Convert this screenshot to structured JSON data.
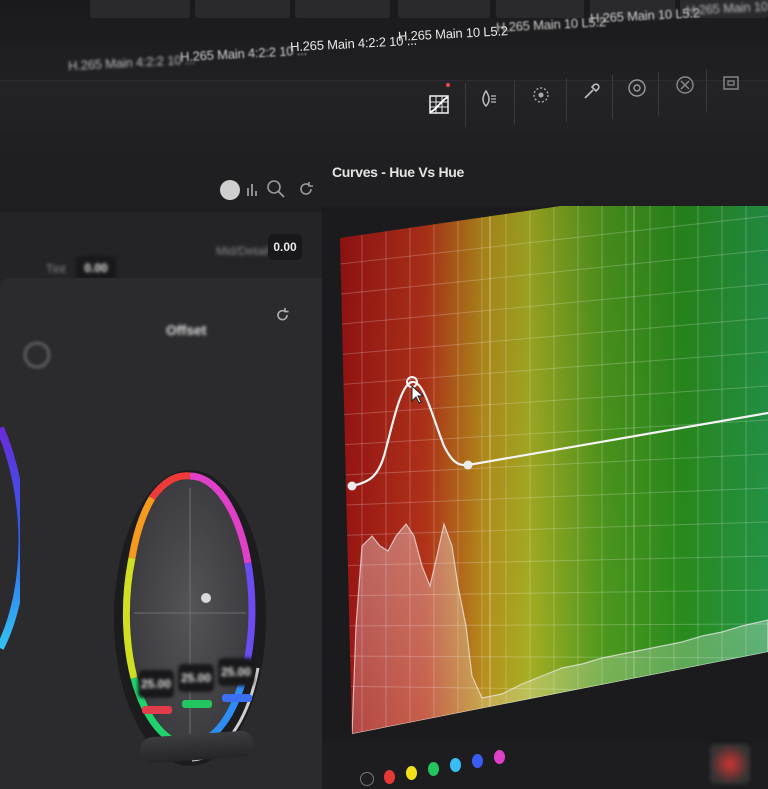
{
  "codec_strip": {
    "labels": [
      "",
      "H.265 Main 4:2:2 10 ...",
      "H.265 Main 4:2:2 10 ...",
      "H.265 Main 4:2:2 10 ...",
      "H.265 Main 10 L5.2",
      "H.265 Main 10 L5.2",
      "H.265 Main 10 L5.2",
      "H.265 Main 10 L5.2"
    ]
  },
  "toolbar": {
    "icons": [
      "curves-grid-icon",
      "qualifier-icon",
      "window-icon",
      "eyedropper-icon",
      "blur-icon",
      "key-icon",
      "sizing-icon"
    ]
  },
  "left_panel": {
    "header_icons": [
      "mode-icon",
      "level-icon",
      "zoom-icon",
      "reset-icon"
    ],
    "temp_value": "0.00",
    "mid_detail_value": "0.00",
    "wheel_title": "Offset",
    "offset_values": [
      "25.00",
      "25.00",
      "25.00"
    ],
    "bar_colors": [
      "#e23b4a",
      "#22c55e",
      "#3b6ff5"
    ]
  },
  "curves": {
    "title": "Curves - Hue Vs Hue"
  },
  "bottom_bar": {
    "swatch_colors": [
      "#e53935",
      "#f4e11a",
      "#22c55e",
      "#38bdf8",
      "#3b5bf5",
      "#e040c8"
    ]
  },
  "colors": {
    "accent_red": "#e05050",
    "panel": "#2b2b2e",
    "background": "#151516"
  }
}
